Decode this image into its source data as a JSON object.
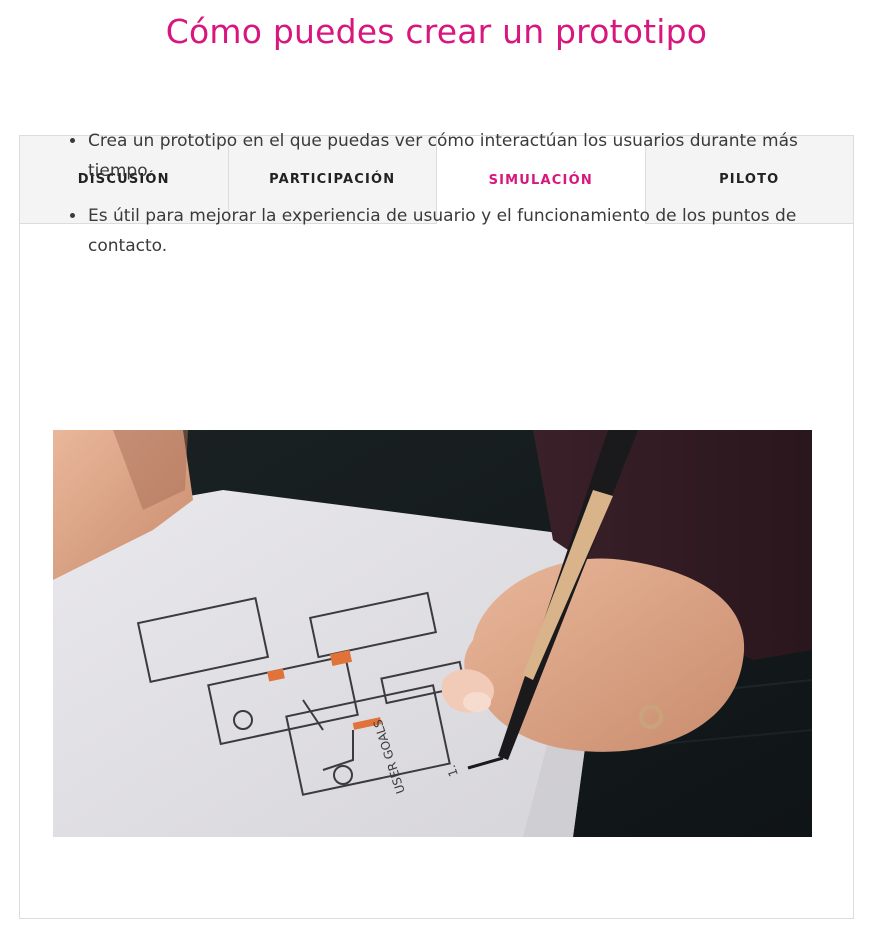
{
  "page": {
    "title": "Cómo puedes crear un prototipo"
  },
  "tabs": [
    {
      "label": "DISCUSIÓN",
      "active": false
    },
    {
      "label": "PARTICIPACIÓN",
      "active": false
    },
    {
      "label": "SIMULACIÓN",
      "active": true
    },
    {
      "label": "PILOTO",
      "active": false
    }
  ],
  "content": {
    "bullets": [
      "Crea un prototipo en el que puedas ver cómo interactúan los usuarios durante más tiempo.",
      "Es útil para mejorar la experiencia de usuario y el funcionamiento de los puntos de contacto."
    ],
    "image": {
      "sketch_text": "USER GOALS",
      "sketch_number": "1."
    }
  },
  "colors": {
    "accent": "#d8177e",
    "tab_inactive_bg": "#f4f4f4",
    "border": "#dcdcdc"
  }
}
